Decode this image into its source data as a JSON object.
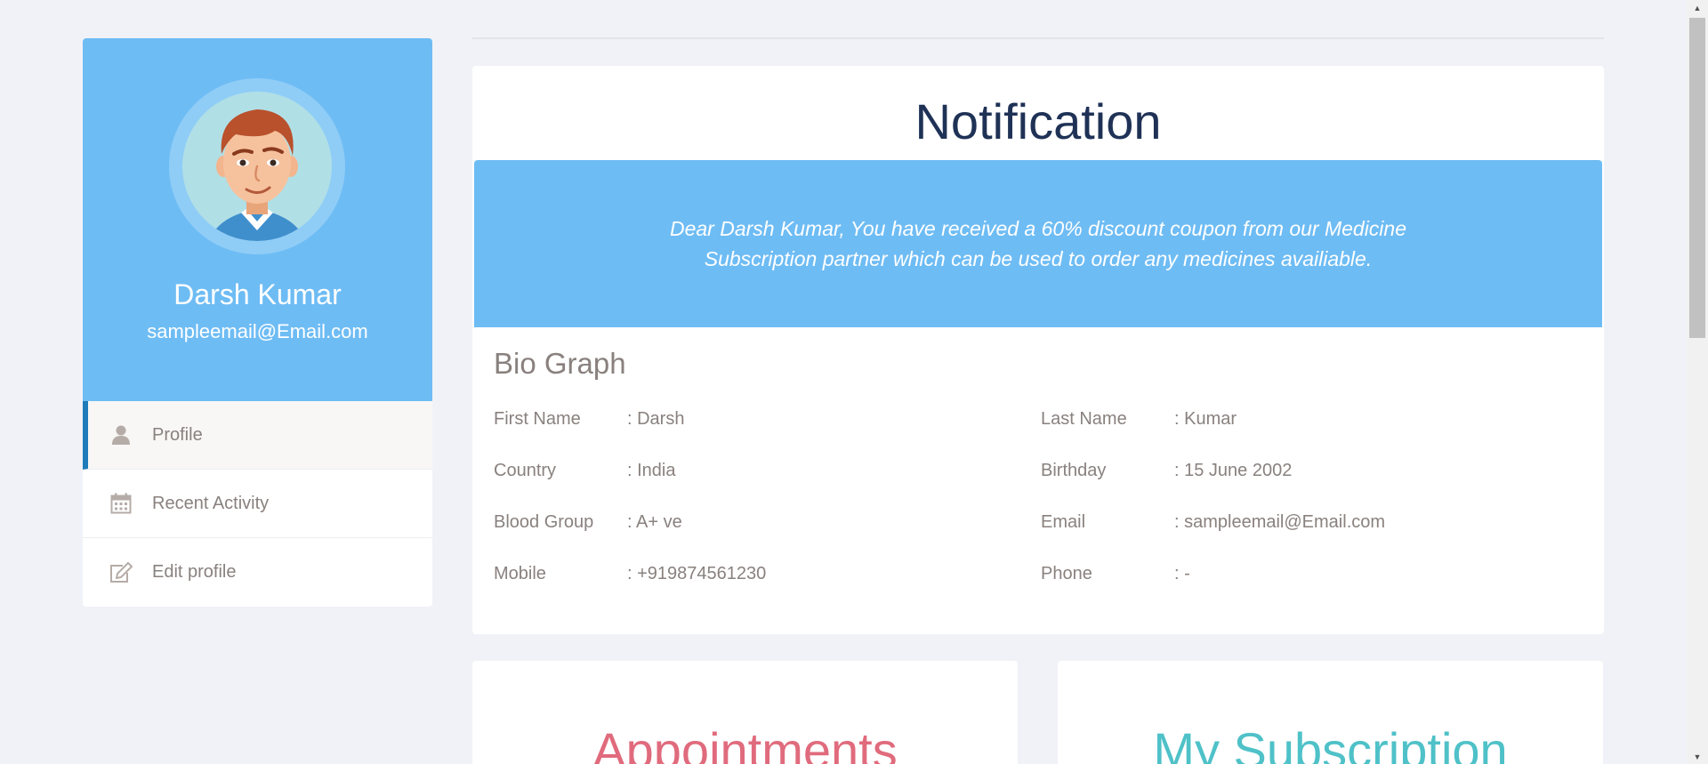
{
  "user": {
    "name": "Darsh Kumar",
    "email": "sampleemail@Email.com"
  },
  "sidebar": {
    "items": [
      {
        "label": "Profile",
        "icon": "user-icon",
        "active": true
      },
      {
        "label": "Recent Activity",
        "icon": "calendar-icon",
        "active": false
      },
      {
        "label": "Edit profile",
        "icon": "edit-icon",
        "active": false
      }
    ]
  },
  "notification": {
    "title": "Notification",
    "message": "Dear Darsh Kumar, You have received a 60% discount coupon from our Medicine Subscription partner which can be used to order any medicines availiable."
  },
  "bio": {
    "title": "Bio Graph",
    "rows": [
      [
        {
          "label": "First Name",
          "value": ": Darsh"
        },
        {
          "label": "Last Name",
          "value": ": Kumar"
        }
      ],
      [
        {
          "label": "Country",
          "value": ": India"
        },
        {
          "label": "Birthday",
          "value": ": 15 June 2002"
        }
      ],
      [
        {
          "label": "Blood Group",
          "value": ": A+ ve"
        },
        {
          "label": "Email",
          "value": ": sampleemail@Email.com"
        }
      ],
      [
        {
          "label": "Mobile",
          "value": ": +919874561230"
        },
        {
          "label": "Phone",
          "value": ": -"
        }
      ]
    ]
  },
  "cards": {
    "appointments": "Appointments",
    "subscription": "My Subscription"
  },
  "colors": {
    "accent_blue": "#6ebcf4",
    "title_navy": "#1f3256",
    "appointments_pink": "#e06b7d",
    "subscription_teal": "#4fc1c8",
    "active_bar": "#1f7cba"
  }
}
